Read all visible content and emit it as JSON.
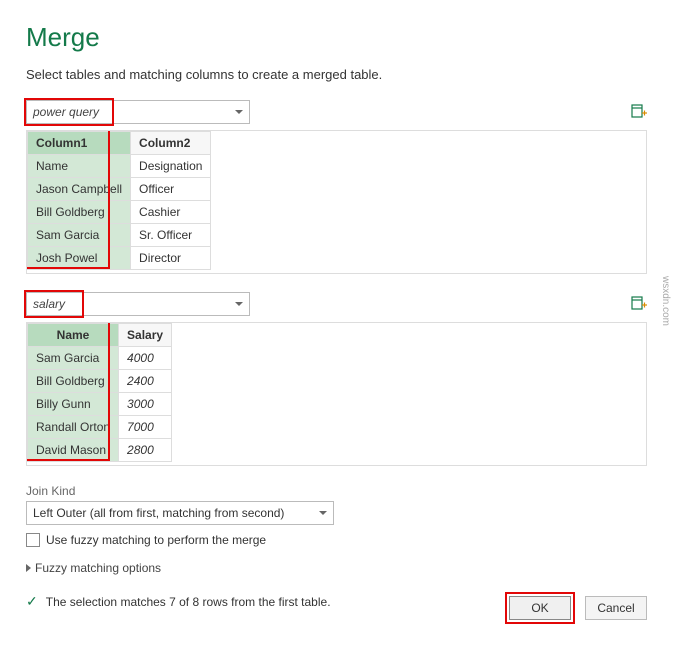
{
  "title": "Merge",
  "description": "Select tables and matching columns to create a merged table.",
  "table1": {
    "selected_source": "power query",
    "columns": [
      "Column1",
      "Column2"
    ],
    "rows": [
      [
        "Name",
        "Designation"
      ],
      [
        "Jason Campbell",
        "Officer"
      ],
      [
        "Bill Goldberg",
        "Cashier"
      ],
      [
        "Sam Garcia",
        "Sr. Officer"
      ],
      [
        "Josh Powel",
        "Director"
      ]
    ]
  },
  "table2": {
    "selected_source": "salary",
    "columns": [
      "Name",
      "Salary"
    ],
    "rows": [
      [
        "Sam Garcia",
        "4000"
      ],
      [
        "Bill Goldberg",
        "2400"
      ],
      [
        "Billy Gunn",
        "3000"
      ],
      [
        "Randall Orton",
        "7000"
      ],
      [
        "David Mason",
        "2800"
      ]
    ]
  },
  "join": {
    "label": "Join Kind",
    "selected": "Left Outer (all from first, matching from second)"
  },
  "fuzzy": {
    "checkbox_label": "Use fuzzy matching to perform the merge",
    "options_label": "Fuzzy matching options"
  },
  "status": "The selection matches 7 of 8 rows from the first table.",
  "buttons": {
    "ok": "OK",
    "cancel": "Cancel"
  },
  "watermark": "wsxdn.com"
}
